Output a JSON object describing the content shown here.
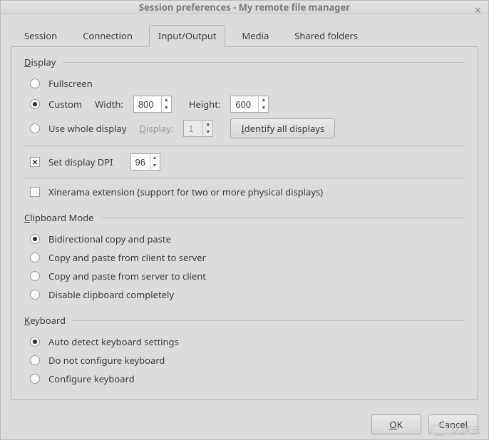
{
  "window": {
    "title": "Session preferences - My remote file manager",
    "close_icon": "×"
  },
  "tabs": [
    {
      "label": "Session",
      "active": false
    },
    {
      "label": "Connection",
      "active": false
    },
    {
      "label": "Input/Output",
      "active": true
    },
    {
      "label": "Media",
      "active": false
    },
    {
      "label": "Shared folders",
      "active": false
    }
  ],
  "groups": {
    "display": {
      "title": "Display",
      "underline_index": 0,
      "fullscreen": {
        "label": "Fullscreen",
        "checked": false
      },
      "custom": {
        "label": "Custom",
        "checked": true
      },
      "width_label": "Width:",
      "width_value": "800",
      "height_label": "Height:",
      "height_value": "600",
      "use_whole": {
        "label": "Use whole display",
        "checked": false
      },
      "display_label": "Display:",
      "display_value": "1",
      "identify_button": "Identify all displays",
      "set_dpi": {
        "label": "Set display DPI",
        "checked": true
      },
      "dpi_value": "96",
      "xinerama": {
        "label": "Xinerama extension (support for two or more physical displays)",
        "checked": false
      }
    },
    "clipboard": {
      "title": "Clipboard Mode",
      "underline_index": 0,
      "options": [
        {
          "label": "Bidirectional copy and paste",
          "checked": true
        },
        {
          "label": "Copy and paste from client to server",
          "checked": false
        },
        {
          "label": "Copy and paste from server to client",
          "checked": false
        },
        {
          "label": "Disable clipboard completely",
          "checked": false
        }
      ]
    },
    "keyboard": {
      "title": "Keyboard",
      "underline_index": 0,
      "options": [
        {
          "label": "Auto detect keyboard settings",
          "checked": true
        },
        {
          "label": "Do not configure keyboard",
          "checked": false
        },
        {
          "label": "Configure keyboard",
          "checked": false
        }
      ]
    }
  },
  "footer": {
    "ok": "OK",
    "ok_underline_index": 0,
    "cancel": "Cancel"
  },
  "watermark": "亿速云"
}
